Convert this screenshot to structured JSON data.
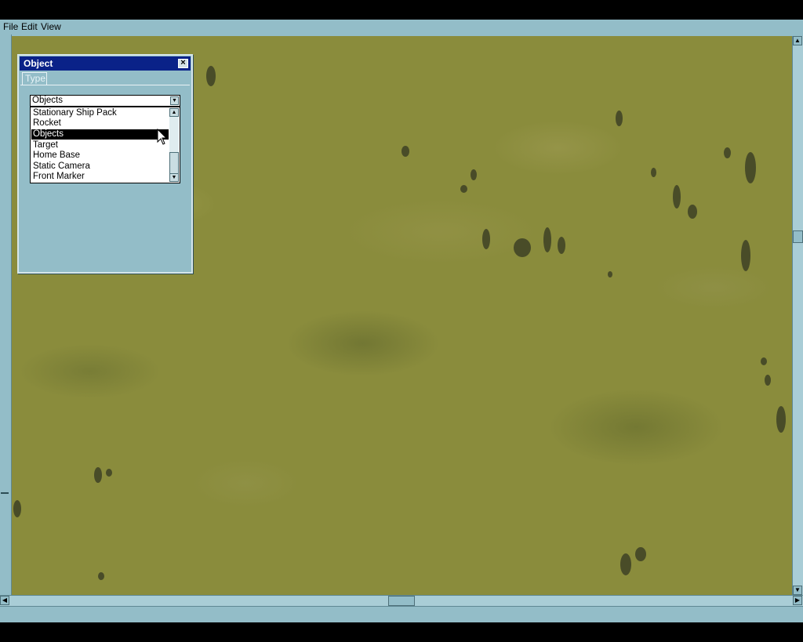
{
  "menu": {
    "file": "File",
    "edit": "Edit",
    "view": "View"
  },
  "object_window": {
    "title": "Object",
    "close_label": "×",
    "tab": "Type",
    "combo_value": "Objects",
    "options": [
      {
        "label": "Stationary Ship Pack"
      },
      {
        "label": "Rocket"
      },
      {
        "label": "Objects"
      },
      {
        "label": "Target"
      },
      {
        "label": "Home Base"
      },
      {
        "label": "Static Camera"
      },
      {
        "label": "Front Marker"
      }
    ],
    "selected_option": "Objects"
  },
  "icons": {
    "close": "close-icon",
    "combo_arrow": "chevron-down-icon",
    "cursor": "mouse-pointer-icon"
  },
  "colors": {
    "chrome": "#93bdc8",
    "title_bar": "#0a2288",
    "terrain": "#8a8c3c",
    "selection": "#000000"
  }
}
